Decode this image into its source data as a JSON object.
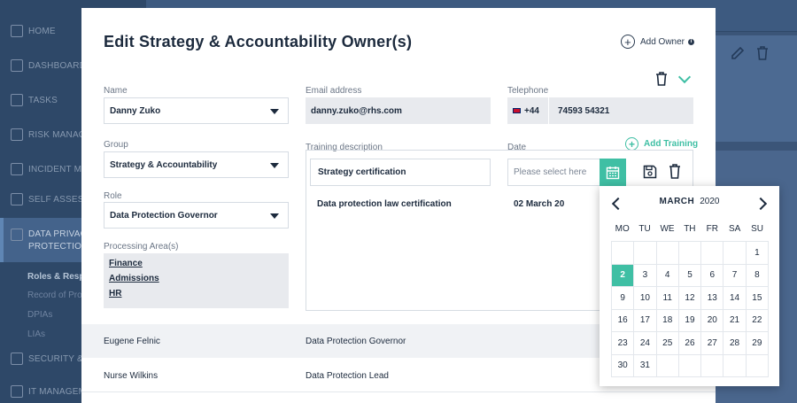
{
  "sidebar": {
    "items": [
      {
        "label": "HOME"
      },
      {
        "label": "DASHBOARD"
      },
      {
        "label": "TASKS"
      },
      {
        "label": "RISK MANAGE"
      },
      {
        "label": "INCIDENT MA"
      },
      {
        "label": "SELF ASSESS"
      },
      {
        "label": "DATA PRIVAC",
        "label2": "PROTECTION"
      },
      {
        "label": "SECURITY & S"
      },
      {
        "label": "IT MANAGEM"
      }
    ],
    "sub_items": [
      "Roles & Respo",
      "Record of Pro",
      "DPIAs",
      "LIAs"
    ]
  },
  "modal": {
    "title": "Edit Strategy & Accountability Owner(s)",
    "add_owner_label": "Add Owner",
    "name": {
      "label": "Name",
      "value": "Danny Zuko"
    },
    "email": {
      "label": "Email address",
      "value": "danny.zuko@rhs.com"
    },
    "telephone": {
      "label": "Telephone",
      "country_code": "+44",
      "number": "74593 54321"
    },
    "group": {
      "label": "Group",
      "value": "Strategy & Accountability"
    },
    "role": {
      "label": "Role",
      "value": "Data Protection Governor"
    },
    "processing_area": {
      "label": "Processing Area(s)",
      "items": [
        "Finance",
        "Admissions",
        "HR"
      ]
    },
    "training": {
      "description_label": "Training description",
      "date_label": "Date",
      "add_label": "Add Training",
      "new_value": "Strategy certification",
      "date_placeholder": "Please select here",
      "rows": [
        {
          "description": "Data protection law certification",
          "date": "02 March 20"
        }
      ]
    },
    "owners": [
      {
        "name": "Eugene Felnic",
        "role": "Data Protection Governor"
      },
      {
        "name": "Nurse Wilkins",
        "role": "Data Protection Lead"
      }
    ]
  },
  "datepicker": {
    "month": "MARCH",
    "year": "2020",
    "weekdays": [
      "MO",
      "TU",
      "WE",
      "TH",
      "FR",
      "SA",
      "SU"
    ],
    "selected": "2",
    "weeks": [
      [
        "",
        "",
        "",
        "",
        "",
        "",
        "1"
      ],
      [
        "2",
        "3",
        "4",
        "5",
        "6",
        "7",
        "8"
      ],
      [
        "9",
        "10",
        "11",
        "12",
        "13",
        "14",
        "15"
      ],
      [
        "16",
        "17",
        "18",
        "19",
        "20",
        "21",
        "22"
      ],
      [
        "23",
        "24",
        "25",
        "26",
        "27",
        "28",
        "29"
      ],
      [
        "30",
        "31",
        "",
        "",
        "",
        "",
        ""
      ]
    ]
  },
  "colors": {
    "accent": "#3fbfa4",
    "sidebar": "#2e4868",
    "text": "#1c2a3d"
  },
  "icons": [
    "home-icon",
    "dashboard-icon",
    "tasks-icon",
    "chart-icon",
    "tag-icon",
    "check-icon",
    "document-icon",
    "shield-icon",
    "computer-icon",
    "trash-icon",
    "edit-icon",
    "calendar-icon",
    "save-icon",
    "plus-circle-icon",
    "info-icon",
    "chevron-down-icon",
    "flag-icon"
  ]
}
